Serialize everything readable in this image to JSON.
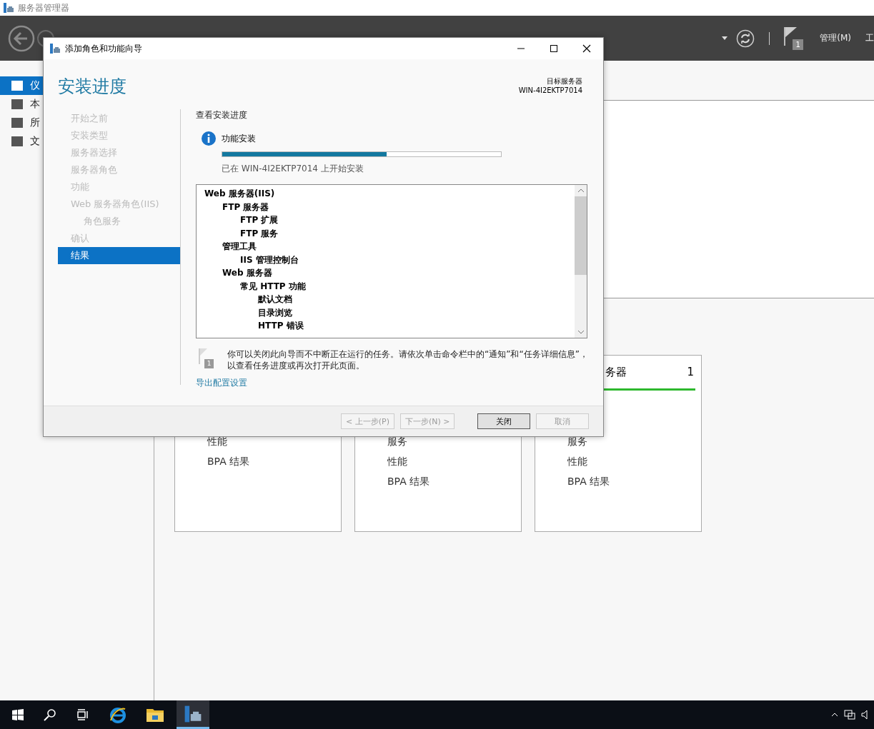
{
  "app_title": "服务器管理器",
  "header": {
    "notification_count": "1",
    "menus": [
      "管理(M)",
      "工"
    ]
  },
  "sidebar": {
    "items": [
      {
        "label": "仪",
        "selected": true
      },
      {
        "label": "本",
        "selected": false
      },
      {
        "label": "所",
        "selected": false
      },
      {
        "label": "文",
        "selected": false
      }
    ]
  },
  "tiles": [
    {
      "items": [
        "性能",
        "BPA 结果"
      ]
    },
    {
      "items": [
        "服务",
        "性能",
        "BPA 结果"
      ]
    },
    {
      "title": "务器",
      "count": "1",
      "items": [
        "服务",
        "性能",
        "BPA 结果"
      ]
    }
  ],
  "dialog": {
    "title": "添加角色和功能向导",
    "heading": "安装进度",
    "target_label": "目标服务器",
    "target_server": "WIN-4I2EKTP7014",
    "nav": [
      {
        "label": "开始之前",
        "selected": false
      },
      {
        "label": "安装类型",
        "selected": false
      },
      {
        "label": "服务器选择",
        "selected": false
      },
      {
        "label": "服务器角色",
        "selected": false
      },
      {
        "label": "功能",
        "selected": false
      },
      {
        "label": "Web 服务器角色(IIS)",
        "selected": false,
        "children": [
          {
            "label": "角色服务",
            "selected": false
          }
        ]
      },
      {
        "label": "确认",
        "selected": false
      },
      {
        "label": "结果",
        "selected": true
      }
    ],
    "section_title": "查看安装进度",
    "status_title": "功能安装",
    "progress": {
      "level": 0.59
    },
    "status_text": "已在 WIN-4I2EKTP7014 上开始安装",
    "features": [
      {
        "label": "Web 服务器(IIS)",
        "children": [
          {
            "label": "FTP 服务器",
            "children": [
              {
                "label": "FTP 扩展"
              },
              {
                "label": "FTP 服务"
              }
            ]
          },
          {
            "label": "管理工具",
            "children": [
              {
                "label": "IIS 管理控制台"
              }
            ]
          },
          {
            "label": "Web 服务器",
            "children": [
              {
                "label": "常见 HTTP 功能",
                "children": [
                  {
                    "label": "默认文档"
                  },
                  {
                    "label": "目录浏览"
                  },
                  {
                    "label": "HTTP 错误"
                  }
                ]
              }
            ]
          }
        ]
      }
    ],
    "notice": "你可以关闭此向导而不中断正在运行的任务。请依次单击命令栏中的“通知”和“任务详细信息”，以查看任务进度或再次打开此页面。",
    "notice_badge": "1",
    "export_link": "导出配置设置",
    "buttons": [
      {
        "label": "< 上一步(P)",
        "disabled": true,
        "default": false
      },
      {
        "label": "下一步(N) >",
        "disabled": true,
        "default": false
      },
      {
        "label": "关闭",
        "disabled": false,
        "default": true
      },
      {
        "label": "取消",
        "disabled": true,
        "default": false
      }
    ]
  }
}
